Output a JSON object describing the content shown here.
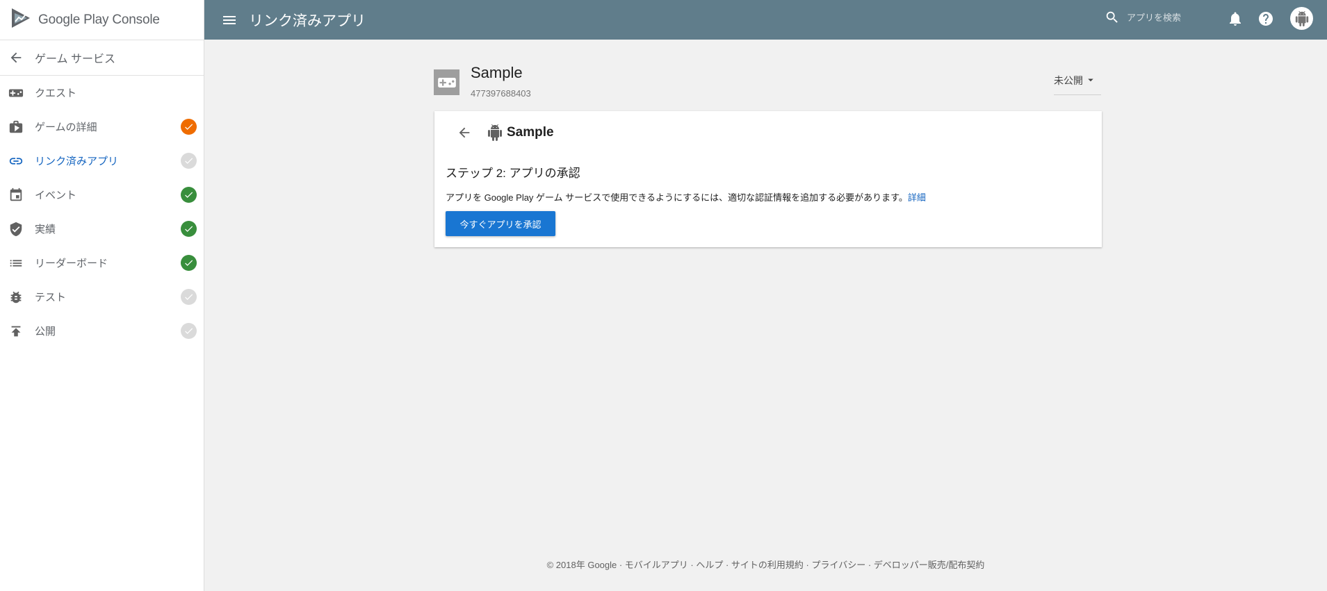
{
  "brand": {
    "google": "Google Play",
    "console": "Console"
  },
  "sidebar": {
    "back_label": "ゲーム サービス",
    "items": [
      {
        "label": "クエスト",
        "icon": "gamepad-icon",
        "status": "none"
      },
      {
        "label": "ゲームの詳細",
        "icon": "briefcase-icon",
        "status": "warning"
      },
      {
        "label": "リンク済みアプリ",
        "icon": "link-icon",
        "status": "pending"
      },
      {
        "label": "イベント",
        "icon": "calendar-icon",
        "status": "done"
      },
      {
        "label": "実績",
        "icon": "shield-check-icon",
        "status": "done"
      },
      {
        "label": "リーダーボード",
        "icon": "list-icon",
        "status": "done"
      },
      {
        "label": "テスト",
        "icon": "bug-icon",
        "status": "pending"
      },
      {
        "label": "公開",
        "icon": "publish-icon",
        "status": "pending"
      }
    ]
  },
  "topbar": {
    "title": "リンク済みアプリ",
    "search_placeholder": "アプリを検索"
  },
  "app": {
    "name": "Sample",
    "id": "477397688403",
    "publish_state": "未公開"
  },
  "card": {
    "app_name": "Sample",
    "step_title": "ステップ 2: アプリの承認",
    "description": "アプリを Google Play ゲーム サービスで使用できるようにするには、適切な認証情報を追加する必要があります。",
    "details_link": "詳細",
    "approve_button": "今すぐアプリを承認"
  },
  "footer": {
    "text": "© 2018年 Google · モバイルアプリ · ヘルプ · サイトの利用規約 · プライバシー · デベロッパー販売/配布契約"
  },
  "colors": {
    "topbar": "#607d8b",
    "accent": "#1565c0",
    "button": "#1976d2",
    "status_warning": "#ef6c00",
    "status_done": "#388e3c",
    "status_pending": "#dadada"
  }
}
